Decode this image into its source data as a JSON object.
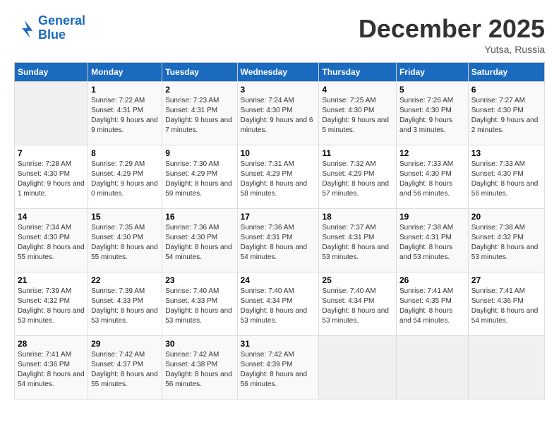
{
  "logo": {
    "line1": "General",
    "line2": "Blue"
  },
  "title": {
    "month_year": "December 2025",
    "location": "Yutsa, Russia"
  },
  "headers": [
    "Sunday",
    "Monday",
    "Tuesday",
    "Wednesday",
    "Thursday",
    "Friday",
    "Saturday"
  ],
  "weeks": [
    [
      {
        "day": "",
        "sunrise": "",
        "sunset": "",
        "daylight": ""
      },
      {
        "day": "1",
        "sunrise": "Sunrise: 7:22 AM",
        "sunset": "Sunset: 4:31 PM",
        "daylight": "Daylight: 9 hours and 9 minutes."
      },
      {
        "day": "2",
        "sunrise": "Sunrise: 7:23 AM",
        "sunset": "Sunset: 4:31 PM",
        "daylight": "Daylight: 9 hours and 7 minutes."
      },
      {
        "day": "3",
        "sunrise": "Sunrise: 7:24 AM",
        "sunset": "Sunset: 4:30 PM",
        "daylight": "Daylight: 9 hours and 6 minutes."
      },
      {
        "day": "4",
        "sunrise": "Sunrise: 7:25 AM",
        "sunset": "Sunset: 4:30 PM",
        "daylight": "Daylight: 9 hours and 5 minutes."
      },
      {
        "day": "5",
        "sunrise": "Sunrise: 7:26 AM",
        "sunset": "Sunset: 4:30 PM",
        "daylight": "Daylight: 9 hours and 3 minutes."
      },
      {
        "day": "6",
        "sunrise": "Sunrise: 7:27 AM",
        "sunset": "Sunset: 4:30 PM",
        "daylight": "Daylight: 9 hours and 2 minutes."
      }
    ],
    [
      {
        "day": "7",
        "sunrise": "Sunrise: 7:28 AM",
        "sunset": "Sunset: 4:30 PM",
        "daylight": "Daylight: 9 hours and 1 minute."
      },
      {
        "day": "8",
        "sunrise": "Sunrise: 7:29 AM",
        "sunset": "Sunset: 4:29 PM",
        "daylight": "Daylight: 9 hours and 0 minutes."
      },
      {
        "day": "9",
        "sunrise": "Sunrise: 7:30 AM",
        "sunset": "Sunset: 4:29 PM",
        "daylight": "Daylight: 8 hours and 59 minutes."
      },
      {
        "day": "10",
        "sunrise": "Sunrise: 7:31 AM",
        "sunset": "Sunset: 4:29 PM",
        "daylight": "Daylight: 8 hours and 58 minutes."
      },
      {
        "day": "11",
        "sunrise": "Sunrise: 7:32 AM",
        "sunset": "Sunset: 4:29 PM",
        "daylight": "Daylight: 8 hours and 57 minutes."
      },
      {
        "day": "12",
        "sunrise": "Sunrise: 7:33 AM",
        "sunset": "Sunset: 4:30 PM",
        "daylight": "Daylight: 8 hours and 56 minutes."
      },
      {
        "day": "13",
        "sunrise": "Sunrise: 7:33 AM",
        "sunset": "Sunset: 4:30 PM",
        "daylight": "Daylight: 8 hours and 56 minutes."
      }
    ],
    [
      {
        "day": "14",
        "sunrise": "Sunrise: 7:34 AM",
        "sunset": "Sunset: 4:30 PM",
        "daylight": "Daylight: 8 hours and 55 minutes."
      },
      {
        "day": "15",
        "sunrise": "Sunrise: 7:35 AM",
        "sunset": "Sunset: 4:30 PM",
        "daylight": "Daylight: 8 hours and 55 minutes."
      },
      {
        "day": "16",
        "sunrise": "Sunrise: 7:36 AM",
        "sunset": "Sunset: 4:30 PM",
        "daylight": "Daylight: 8 hours and 54 minutes."
      },
      {
        "day": "17",
        "sunrise": "Sunrise: 7:36 AM",
        "sunset": "Sunset: 4:31 PM",
        "daylight": "Daylight: 8 hours and 54 minutes."
      },
      {
        "day": "18",
        "sunrise": "Sunrise: 7:37 AM",
        "sunset": "Sunset: 4:31 PM",
        "daylight": "Daylight: 8 hours and 53 minutes."
      },
      {
        "day": "19",
        "sunrise": "Sunrise: 7:38 AM",
        "sunset": "Sunset: 4:31 PM",
        "daylight": "Daylight: 8 hours and 53 minutes."
      },
      {
        "day": "20",
        "sunrise": "Sunrise: 7:38 AM",
        "sunset": "Sunset: 4:32 PM",
        "daylight": "Daylight: 8 hours and 53 minutes."
      }
    ],
    [
      {
        "day": "21",
        "sunrise": "Sunrise: 7:39 AM",
        "sunset": "Sunset: 4:32 PM",
        "daylight": "Daylight: 8 hours and 53 minutes."
      },
      {
        "day": "22",
        "sunrise": "Sunrise: 7:39 AM",
        "sunset": "Sunset: 4:33 PM",
        "daylight": "Daylight: 8 hours and 53 minutes."
      },
      {
        "day": "23",
        "sunrise": "Sunrise: 7:40 AM",
        "sunset": "Sunset: 4:33 PM",
        "daylight": "Daylight: 8 hours and 53 minutes."
      },
      {
        "day": "24",
        "sunrise": "Sunrise: 7:40 AM",
        "sunset": "Sunset: 4:34 PM",
        "daylight": "Daylight: 8 hours and 53 minutes."
      },
      {
        "day": "25",
        "sunrise": "Sunrise: 7:40 AM",
        "sunset": "Sunset: 4:34 PM",
        "daylight": "Daylight: 8 hours and 53 minutes."
      },
      {
        "day": "26",
        "sunrise": "Sunrise: 7:41 AM",
        "sunset": "Sunset: 4:35 PM",
        "daylight": "Daylight: 8 hours and 54 minutes."
      },
      {
        "day": "27",
        "sunrise": "Sunrise: 7:41 AM",
        "sunset": "Sunset: 4:36 PM",
        "daylight": "Daylight: 8 hours and 54 minutes."
      }
    ],
    [
      {
        "day": "28",
        "sunrise": "Sunrise: 7:41 AM",
        "sunset": "Sunset: 4:36 PM",
        "daylight": "Daylight: 8 hours and 54 minutes."
      },
      {
        "day": "29",
        "sunrise": "Sunrise: 7:42 AM",
        "sunset": "Sunset: 4:37 PM",
        "daylight": "Daylight: 8 hours and 55 minutes."
      },
      {
        "day": "30",
        "sunrise": "Sunrise: 7:42 AM",
        "sunset": "Sunset: 4:38 PM",
        "daylight": "Daylight: 8 hours and 56 minutes."
      },
      {
        "day": "31",
        "sunrise": "Sunrise: 7:42 AM",
        "sunset": "Sunset: 4:39 PM",
        "daylight": "Daylight: 8 hours and 56 minutes."
      },
      {
        "day": "",
        "sunrise": "",
        "sunset": "",
        "daylight": ""
      },
      {
        "day": "",
        "sunrise": "",
        "sunset": "",
        "daylight": ""
      },
      {
        "day": "",
        "sunrise": "",
        "sunset": "",
        "daylight": ""
      }
    ]
  ]
}
